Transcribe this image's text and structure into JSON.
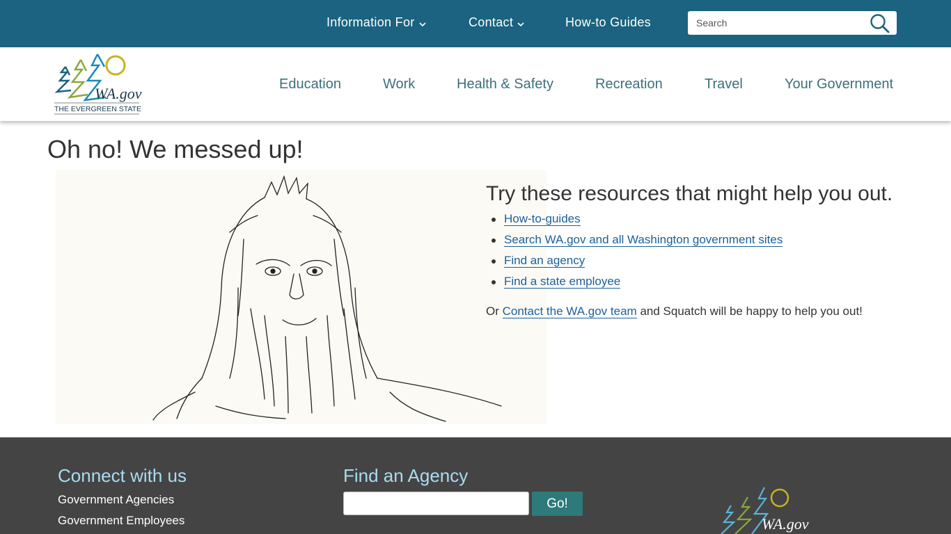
{
  "topbar": {
    "nav": [
      {
        "label": "Information For",
        "has_dropdown": true
      },
      {
        "label": "Contact",
        "has_dropdown": true
      },
      {
        "label": "How-to Guides",
        "has_dropdown": false
      }
    ],
    "search": {
      "placeholder": "Search",
      "value": "",
      "icon": "search-icon"
    },
    "background_color": "#1b6380"
  },
  "header": {
    "logo": {
      "text": "WA.gov",
      "tagline": "THE EVERGREEN STATE"
    },
    "nav": [
      "Education",
      "Work",
      "Health & Safety",
      "Recreation",
      "Travel",
      "Your Government"
    ],
    "nav_color": "#3d6f7c"
  },
  "main": {
    "title": "Oh no! We messed up!",
    "resources": {
      "heading": "Try these resources that might help you out.",
      "links": [
        "How-to-guides",
        "Search WA.gov and all Washington government sites",
        "Find an agency",
        "Find a state employee"
      ]
    },
    "help": {
      "prefix": "Or",
      "link": "Contact the WA.gov team",
      "suffix": "and Squatch will be happy to help you out!"
    },
    "link_color": "#1c5f9a"
  },
  "footer": {
    "connect": {
      "heading": "Connect with us",
      "links": [
        "Government Agencies",
        "Government Employees"
      ]
    },
    "agency": {
      "heading": "Find an Agency",
      "input_value": "",
      "button_label": "Go!"
    },
    "logo_text": "WA.gov",
    "background_color": "#444444",
    "heading_color": "#a8dcf0"
  }
}
